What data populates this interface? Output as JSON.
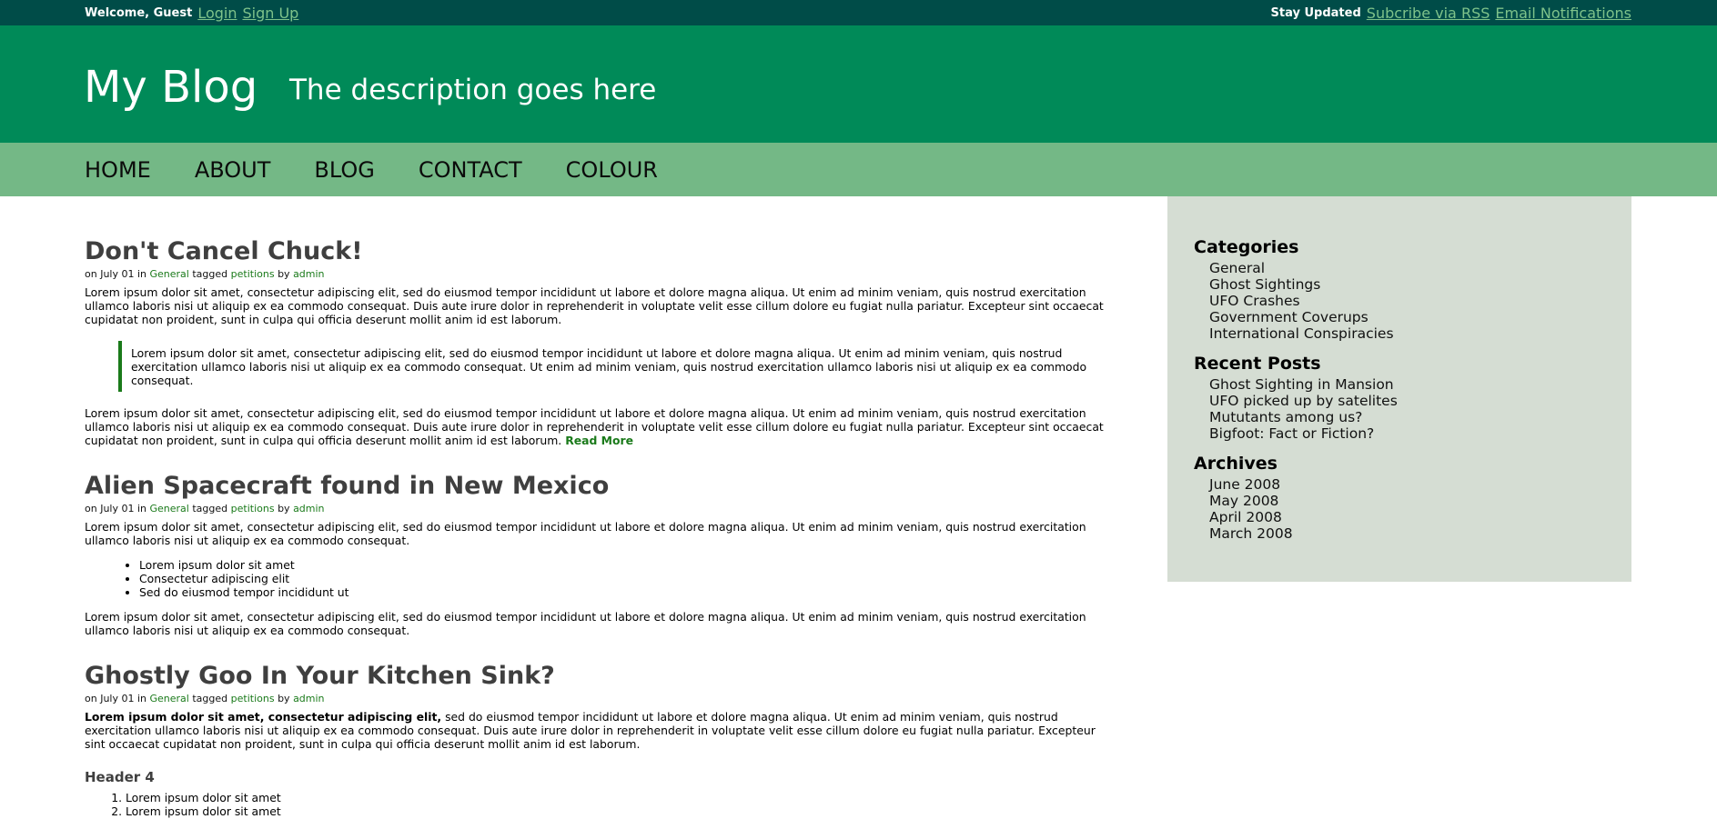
{
  "topbar": {
    "welcome": "Welcome, Guest",
    "login": "Login",
    "signup": "Sign Up",
    "stay_updated": "Stay Updated",
    "rss": "Subcribe via RSS",
    "email": "Email Notifications"
  },
  "header": {
    "title": "My Blog",
    "description": "The description goes here"
  },
  "nav": {
    "items": [
      "HOME",
      "ABOUT",
      "BLOG",
      "CONTACT",
      "COLOUR"
    ]
  },
  "posts": [
    {
      "title": "Don't Cancel Chuck!",
      "meta_prefix": "on July 01 in",
      "category": "General",
      "tagged": "tagged",
      "tag": "petitions",
      "by": "by",
      "author": "admin",
      "para1": "Lorem ipsum dolor sit amet, consectetur adipiscing elit, sed do eiusmod tempor incididunt ut labore et dolore magna aliqua. Ut enim ad minim veniam, quis nostrud exercitation ullamco laboris nisi ut aliquip ex ea commodo consequat. Duis aute irure dolor in reprehenderit in voluptate velit esse cillum dolore eu fugiat nulla pariatur. Excepteur sint occaecat cupidatat non proident, sunt in culpa qui officia deserunt mollit anim id est laborum.",
      "quote": "Lorem ipsum dolor sit amet, consectetur adipiscing elit, sed do eiusmod tempor incididunt ut labore et dolore magna aliqua. Ut enim ad minim veniam, quis nostrud exercitation ullamco laboris nisi ut aliquip ex ea commodo consequat. Ut enim ad minim veniam, quis nostrud exercitation ullamco laboris nisi ut aliquip ex ea commodo consequat.",
      "para2": "Lorem ipsum dolor sit amet, consectetur adipiscing elit, sed do eiusmod tempor incididunt ut labore et dolore magna aliqua. Ut enim ad minim veniam, quis nostrud exercitation ullamco laboris nisi ut aliquip ex ea commodo consequat. Duis aute irure dolor in reprehenderit in voluptate velit esse cillum dolore eu fugiat nulla pariatur. Excepteur sint occaecat cupidatat non proident, sunt in culpa qui officia deserunt mollit anim id est laborum.",
      "read_more": "Read More"
    },
    {
      "title": "Alien Spacecraft found in New Mexico",
      "meta_prefix": "on July 01 in",
      "category": "General",
      "tagged": "tagged",
      "tag": "petitions",
      "by": "by",
      "author": "admin",
      "para1": "Lorem ipsum dolor sit amet, consectetur adipiscing elit, sed do eiusmod tempor incididunt ut labore et dolore magna aliqua. Ut enim ad minim veniam, quis nostrud exercitation ullamco laboris nisi ut aliquip ex ea commodo consequat.",
      "bullets": [
        "Lorem ipsum dolor sit amet",
        "Consectetur adipiscing elit",
        "Sed do eiusmod tempor incididunt ut"
      ],
      "para2": "Lorem ipsum dolor sit amet, consectetur adipiscing elit, sed do eiusmod tempor incididunt ut labore et dolore magna aliqua. Ut enim ad minim veniam, quis nostrud exercitation ullamco laboris nisi ut aliquip ex ea commodo consequat."
    },
    {
      "title": "Ghostly Goo In Your Kitchen Sink?",
      "meta_prefix": "on July 01 in",
      "category": "General",
      "tagged": "tagged",
      "tag": "petitions",
      "by": "by",
      "author": "admin",
      "para1_bold": "Lorem ipsum dolor sit amet, consectetur adipiscing elit,",
      "para1_rest": " sed do eiusmod tempor incididunt ut labore et dolore magna aliqua. Ut enim ad minim veniam, quis nostrud exercitation ullamco laboris nisi ut aliquip ex ea commodo consequat. Duis aute irure dolor in reprehenderit in voluptate velit esse cillum dolore eu fugiat nulla pariatur. Excepteur sint occaecat cupidatat non proident, sunt in culpa qui officia deserunt mollit anim id est laborum.",
      "header4": "Header 4",
      "numbered": [
        "Lorem ipsum dolor sit amet",
        "Lorem ipsum dolor sit amet"
      ]
    }
  ],
  "sidebar": {
    "categories_title": "Categories",
    "categories": [
      "General",
      "Ghost Sightings",
      "UFO Crashes",
      "Government Coverups",
      "International Conspiracies"
    ],
    "recent_title": "Recent Posts",
    "recent": [
      "Ghost Sighting in Mansion",
      "UFO picked up by satelites",
      "Mututants among us?",
      "Bigfoot: Fact or Fiction?"
    ],
    "archives_title": "Archives",
    "archives": [
      "June 2008",
      "May 2008",
      "April 2008",
      "March 2008"
    ]
  }
}
